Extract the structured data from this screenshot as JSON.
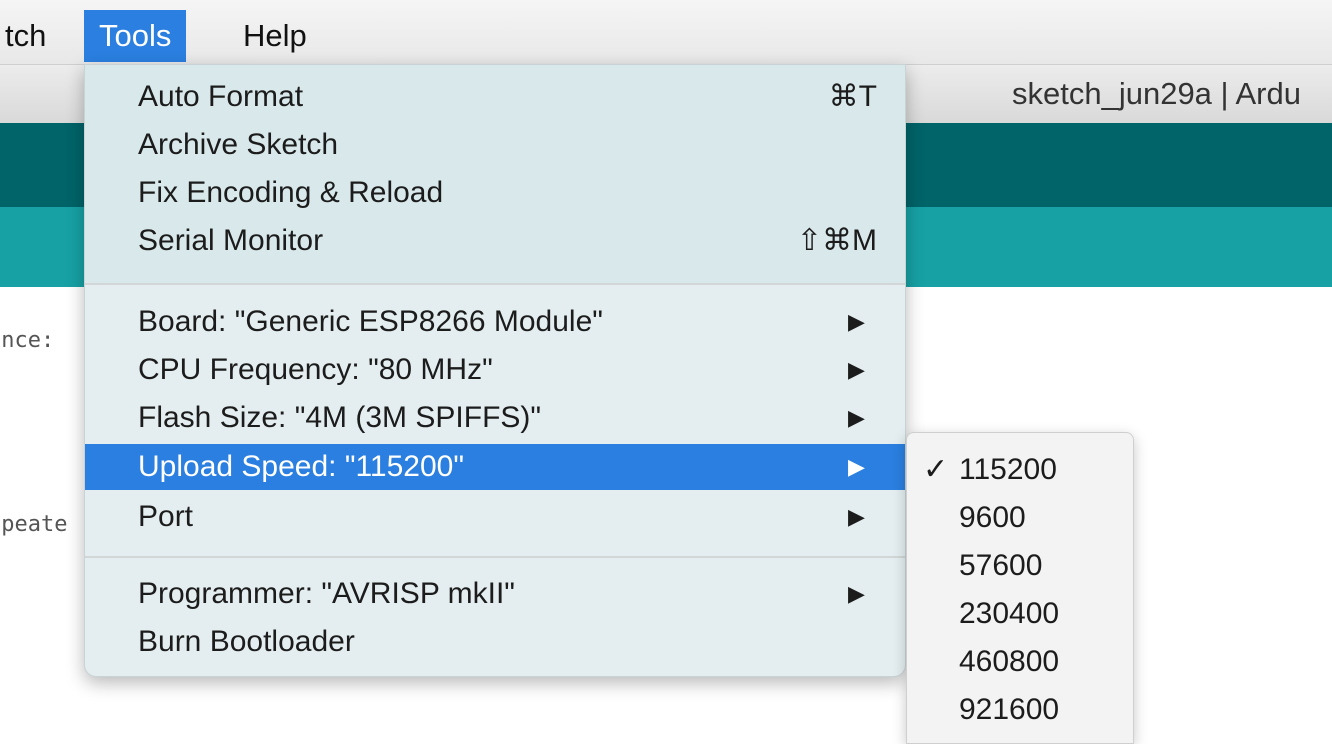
{
  "menubar": {
    "items": [
      {
        "label": "tch"
      },
      {
        "label": "Tools"
      },
      {
        "label": "Help"
      }
    ]
  },
  "window": {
    "title": "sketch_jun29a | Ardu"
  },
  "editor": {
    "lines": [
      "once:",
      "epeate"
    ]
  },
  "tools_menu": {
    "auto_format": {
      "label": "Auto Format",
      "shortcut": "⌘T"
    },
    "archive_sketch": {
      "label": "Archive Sketch"
    },
    "fix_encoding": {
      "label": "Fix Encoding & Reload"
    },
    "serial_monitor": {
      "label": "Serial Monitor",
      "shortcut": "⇧⌘M"
    },
    "board": {
      "label": "Board: \"Generic ESP8266 Module\""
    },
    "cpu_frequency": {
      "label": "CPU Frequency: \"80 MHz\""
    },
    "flash_size": {
      "label": "Flash Size: \"4M (3M SPIFFS)\""
    },
    "upload_speed": {
      "label": "Upload Speed: \"115200\""
    },
    "port": {
      "label": "Port"
    },
    "programmer": {
      "label": "Programmer: \"AVRISP mkII\""
    },
    "burn_bootloader": {
      "label": "Burn Bootloader"
    },
    "arrow": "▶"
  },
  "upload_speed_submenu": {
    "check": "✓",
    "options": [
      "115200",
      "9600",
      "57600",
      "230400",
      "460800",
      "921600"
    ],
    "selected": "115200"
  },
  "colors": {
    "highlight": "#2a7fe0",
    "toolbar_dark": "#006468",
    "toolbar_teal": "#17a1a5"
  }
}
